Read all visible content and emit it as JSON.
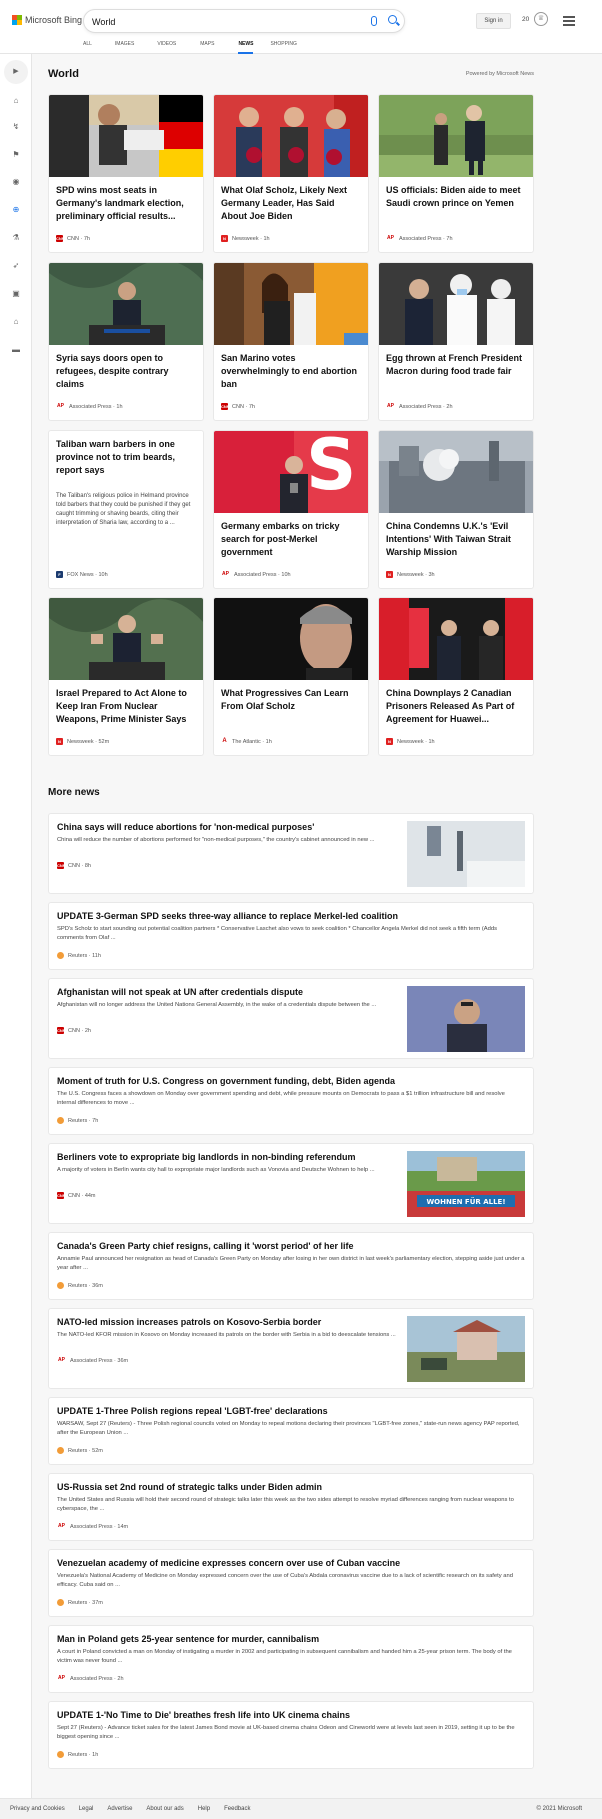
{
  "header": {
    "brand": "Microsoft Bing",
    "search_value": "World",
    "signin_label": "Sign in",
    "points": "20",
    "brand_colors": [
      "#f25022",
      "#7fba00",
      "#00a4ef",
      "#ffb900"
    ]
  },
  "tabs": [
    {
      "label": "ALL"
    },
    {
      "label": "IMAGES"
    },
    {
      "label": "VIDEOS"
    },
    {
      "label": "MAPS"
    },
    {
      "label": "NEWS",
      "active": true
    },
    {
      "label": "SHOPPING"
    }
  ],
  "section": {
    "title": "World",
    "powered": "Powered by Microsoft News"
  },
  "cards": [
    {
      "title": "SPD wins most seats in Germany's landmark election, preliminary official results...",
      "source": "CNN",
      "time": "7h",
      "logo": "cnn"
    },
    {
      "title": "What Olaf Scholz, Likely Next Germany Leader, Has Said About Joe Biden",
      "source": "Newsweek",
      "time": "1h",
      "logo": "nw"
    },
    {
      "title": "US officials: Biden aide to meet Saudi crown prince on Yemen",
      "source": "Associated Press",
      "time": "7h",
      "logo": "ap"
    },
    {
      "title": "Syria says doors open to refugees, despite contrary claims",
      "source": "Associated Press",
      "time": "1h",
      "logo": "ap"
    },
    {
      "title": "San Marino votes overwhelmingly to end abortion ban",
      "source": "CNN",
      "time": "7h",
      "logo": "cnn"
    },
    {
      "title": "Egg thrown at French President Macron during food trade fair",
      "source": "Associated Press",
      "time": "2h",
      "logo": "ap"
    },
    {
      "title": "Taliban warn barbers in one province not to trim beards, report says",
      "summary": "The Taliban's religious police in Helmand province told barbers that they could be punished if they get caught trimming or shaving beards, citing their interpretation of Sharia law, according to a ...",
      "source": "FOX News",
      "time": "10h",
      "logo": "fox"
    },
    {
      "title": "Germany embarks on tricky search for post-Merkel government",
      "source": "Associated Press",
      "time": "10h",
      "logo": "ap"
    },
    {
      "title": "China Condemns U.K.'s 'Evil Intentions' With Taiwan Strait Warship Mission",
      "source": "Newsweek",
      "time": "3h",
      "logo": "nw"
    },
    {
      "title": "Israel Prepared to Act Alone to Keep Iran From Nuclear Weapons, Prime Minister Says",
      "source": "Newsweek",
      "time": "52m",
      "logo": "nw"
    },
    {
      "title": "What Progressives Can Learn From Olaf Scholz",
      "source": "The Atlantic",
      "time": "1h",
      "logo": "atl"
    },
    {
      "title": "China Downplays 2 Canadian Prisoners Released As Part of Agreement for Huawei...",
      "source": "Newsweek",
      "time": "1h",
      "logo": "nw"
    }
  ],
  "more_news": {
    "title": "More news",
    "items": [
      {
        "title": "China says will reduce abortions for 'non-medical purposes'",
        "summary": "China will reduce the number of abortions performed for \"non-medical purposes,\" the country's cabinet announced in new ...",
        "source": "CNN",
        "time": "8h",
        "logo": "cnn"
      },
      {
        "title": "UPDATE 3-German SPD seeks three-way alliance to replace Merkel-led coalition",
        "summary": "SPD's Scholz to start sounding out potential coalition partners * Conservative Laschet also vows to seek coalition * Chancellor Angela Merkel did not seek a fifth term (Adds comments from Olaf ...",
        "source": "Reuters",
        "time": "11h",
        "logo": "reut"
      },
      {
        "title": "Afghanistan will not speak at UN after credentials dispute",
        "summary": "Afghanistan will no longer address the United Nations General Assembly, in the wake of a credentials dispute between the ...",
        "source": "CNN",
        "time": "2h",
        "logo": "cnn"
      },
      {
        "title": "Moment of truth for U.S. Congress on government funding, debt, Biden agenda",
        "summary": "The U.S. Congress faces a showdown on Monday over government spending and debt, while pressure mounts on Democrats to pass a $1 trillion infrastructure bill and resolve internal differences to move ...",
        "source": "Reuters",
        "time": "7h",
        "logo": "reut"
      },
      {
        "title": "Berliners vote to expropriate big landlords in non-binding referendum",
        "summary": "A majority of voters in Berlin wants city hall to expropriate major landlords such as Vonovia and Deutsche Wohnen to help ...",
        "source": "CNN",
        "time": "44m",
        "logo": "cnn",
        "banner": "WOHNEN FÜR ALLE!"
      },
      {
        "title": "Canada's Green Party chief resigns, calling it 'worst period' of her life",
        "summary": "Annamie Paul announced her resignation as head of Canada's Green Party on Monday after losing in her own district in last week's parliamentary election, stepping aside just under a year after ...",
        "source": "Reuters",
        "time": "36m",
        "logo": "reut"
      },
      {
        "title": "NATO-led mission increases patrols on Kosovo-Serbia border",
        "summary": "The NATO-led KFOR mission in Kosovo on Monday increased its patrols on the border with Serbia in a bid to deescalate tensions ...",
        "source": "Associated Press",
        "time": "36m",
        "logo": "ap"
      },
      {
        "title": "UPDATE 1-Three Polish regions repeal 'LGBT-free' declarations",
        "summary": "WARSAW, Sept 27 (Reuters) - Three Polish regional councils voted on Monday to repeal motions declaring their provinces \"LGBT-free zones,\" state-run news agency PAP reported, after the European Union ...",
        "source": "Reuters",
        "time": "52m",
        "logo": "reut"
      },
      {
        "title": "US-Russia set 2nd round of strategic talks under Biden admin",
        "summary": "The United States and Russia will hold their second round of strategic talks later this week as the two sides attempt to resolve myriad differences ranging from nuclear weapons to cyberspace, the ...",
        "source": "Associated Press",
        "time": "14m",
        "logo": "ap"
      },
      {
        "title": "Venezuelan academy of medicine expresses concern over use of Cuban vaccine",
        "summary": "Venezuela's National Academy of Medicine on Monday expressed concern over the use of Cuba's Abdala coronavirus vaccine due to a lack of scientific research on its safety and efficacy. Cuba said on ...",
        "source": "Reuters",
        "time": "37m",
        "logo": "reut"
      },
      {
        "title": "Man in Poland gets 25-year sentence for murder, cannibalism",
        "summary": "A court in Poland convicted a man on Monday of instigating a murder in 2002 and participating in subsequent cannibalism and handed him a 25-year prison term. The body of the victim was never found ...",
        "source": "Associated Press",
        "time": "2h",
        "logo": "ap"
      },
      {
        "title": "UPDATE 1-'No Time to Die' breathes fresh life into UK cinema chains",
        "summary": "Sept 27 (Reuters) - Advance ticket sales for the latest James Bond movie at UK-based cinema chains Odeon and Cineworld were at levels last seen in 2019, setting it up to be the biggest opening since ...",
        "source": "Reuters",
        "time": "1h",
        "logo": "reut"
      }
    ]
  },
  "logos": {
    "cnn": "CNN",
    "ap": "AP",
    "nw": "N",
    "fox": "F",
    "atl": "A"
  },
  "footer": {
    "links": [
      "Privacy and Cookies",
      "Legal",
      "Advertise",
      "About our ads",
      "Help",
      "Feedback"
    ],
    "copyright": "© 2021 Microsoft"
  }
}
